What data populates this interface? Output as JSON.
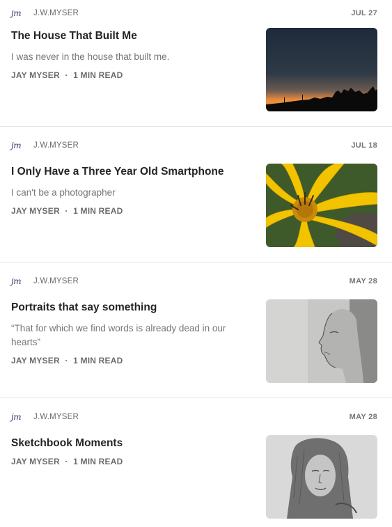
{
  "feed": {
    "posts": [
      {
        "logo": "jm",
        "publication": "J.W.MYSER",
        "date": "JUL 27",
        "title": "The House That Built Me",
        "subtitle": "I was never in the house that built me.",
        "author": "JAY MYSER",
        "separator": "·",
        "read_time": "1 MIN READ"
      },
      {
        "logo": "jm",
        "publication": "J.W.MYSER",
        "date": "JUL 18",
        "title": "I Only Have a Three Year Old Smartphone",
        "subtitle": "I can't be a photographer",
        "author": "JAY MYSER",
        "separator": "·",
        "read_time": "1 MIN READ"
      },
      {
        "logo": "jm",
        "publication": "J.W.MYSER",
        "date": "MAY 28",
        "title": "Portraits that say something",
        "subtitle": "“That for which we find words is already dead in our hearts”",
        "author": "JAY MYSER",
        "separator": "·",
        "read_time": "1 MIN READ"
      },
      {
        "logo": "jm",
        "publication": "J.W.MYSER",
        "date": "MAY 28",
        "title": "Sketchbook Moments",
        "subtitle": "",
        "author": "JAY MYSER",
        "separator": "·",
        "read_time": "1 MIN READ"
      }
    ]
  }
}
